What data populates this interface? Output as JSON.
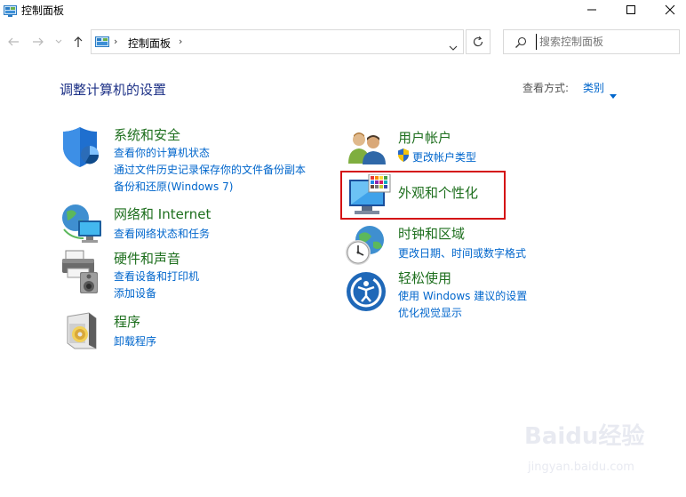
{
  "window": {
    "title": "控制面板"
  },
  "navigation": {
    "address_crumb": "控制面板",
    "search_placeholder": "搜索控制面板"
  },
  "main": {
    "heading": "调整计算机的设置",
    "view_by_label": "查看方式:",
    "view_by_value": "类别"
  },
  "categories_left": [
    {
      "title": "系统和安全",
      "icon": "shield-icon",
      "links": [
        "查看你的计算机状态",
        "通过文件历史记录保存你的文件备份副本",
        "备份和还原(Windows 7)"
      ]
    },
    {
      "title": "网络和 Internet",
      "icon": "globe-network-icon",
      "links": [
        "查看网络状态和任务"
      ]
    },
    {
      "title": "硬件和声音",
      "icon": "printer-speaker-icon",
      "links": [
        "查看设备和打印机",
        "添加设备"
      ]
    },
    {
      "title": "程序",
      "icon": "programs-disc-icon",
      "links": [
        "卸载程序"
      ]
    }
  ],
  "categories_right": [
    {
      "title": "用户帐户",
      "icon": "users-icon",
      "links": [
        "更改帐户类型"
      ]
    },
    {
      "title": "外观和个性化",
      "icon": "monitor-palette-icon",
      "links": []
    },
    {
      "title": "时钟和区域",
      "icon": "clock-globe-icon",
      "links": [
        "更改日期、时间或数字格式"
      ]
    },
    {
      "title": "轻松使用",
      "icon": "ease-of-access-icon",
      "links": [
        "使用 Windows 建议的设置",
        "优化视觉显示"
      ]
    }
  ],
  "watermark": {
    "logo": "Baidu经验",
    "url": "jingyan.baidu.com"
  },
  "colors": {
    "heading": "#1e3287",
    "category_title": "#1e6f1e",
    "link": "#0066cc",
    "highlight_border": "#d40f14"
  }
}
